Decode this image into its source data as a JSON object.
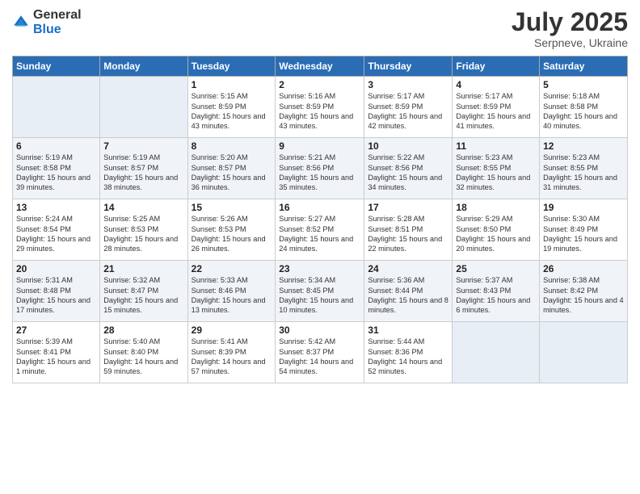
{
  "logo": {
    "general": "General",
    "blue": "Blue"
  },
  "title": "July 2025",
  "subtitle": "Serpneve, Ukraine",
  "header_days": [
    "Sunday",
    "Monday",
    "Tuesday",
    "Wednesday",
    "Thursday",
    "Friday",
    "Saturday"
  ],
  "weeks": [
    [
      {
        "day": "",
        "sunrise": "",
        "sunset": "",
        "daylight": ""
      },
      {
        "day": "",
        "sunrise": "",
        "sunset": "",
        "daylight": ""
      },
      {
        "day": "1",
        "sunrise": "Sunrise: 5:15 AM",
        "sunset": "Sunset: 8:59 PM",
        "daylight": "Daylight: 15 hours and 43 minutes."
      },
      {
        "day": "2",
        "sunrise": "Sunrise: 5:16 AM",
        "sunset": "Sunset: 8:59 PM",
        "daylight": "Daylight: 15 hours and 43 minutes."
      },
      {
        "day": "3",
        "sunrise": "Sunrise: 5:17 AM",
        "sunset": "Sunset: 8:59 PM",
        "daylight": "Daylight: 15 hours and 42 minutes."
      },
      {
        "day": "4",
        "sunrise": "Sunrise: 5:17 AM",
        "sunset": "Sunset: 8:59 PM",
        "daylight": "Daylight: 15 hours and 41 minutes."
      },
      {
        "day": "5",
        "sunrise": "Sunrise: 5:18 AM",
        "sunset": "Sunset: 8:58 PM",
        "daylight": "Daylight: 15 hours and 40 minutes."
      }
    ],
    [
      {
        "day": "6",
        "sunrise": "Sunrise: 5:19 AM",
        "sunset": "Sunset: 8:58 PM",
        "daylight": "Daylight: 15 hours and 39 minutes."
      },
      {
        "day": "7",
        "sunrise": "Sunrise: 5:19 AM",
        "sunset": "Sunset: 8:57 PM",
        "daylight": "Daylight: 15 hours and 38 minutes."
      },
      {
        "day": "8",
        "sunrise": "Sunrise: 5:20 AM",
        "sunset": "Sunset: 8:57 PM",
        "daylight": "Daylight: 15 hours and 36 minutes."
      },
      {
        "day": "9",
        "sunrise": "Sunrise: 5:21 AM",
        "sunset": "Sunset: 8:56 PM",
        "daylight": "Daylight: 15 hours and 35 minutes."
      },
      {
        "day": "10",
        "sunrise": "Sunrise: 5:22 AM",
        "sunset": "Sunset: 8:56 PM",
        "daylight": "Daylight: 15 hours and 34 minutes."
      },
      {
        "day": "11",
        "sunrise": "Sunrise: 5:23 AM",
        "sunset": "Sunset: 8:55 PM",
        "daylight": "Daylight: 15 hours and 32 minutes."
      },
      {
        "day": "12",
        "sunrise": "Sunrise: 5:23 AM",
        "sunset": "Sunset: 8:55 PM",
        "daylight": "Daylight: 15 hours and 31 minutes."
      }
    ],
    [
      {
        "day": "13",
        "sunrise": "Sunrise: 5:24 AM",
        "sunset": "Sunset: 8:54 PM",
        "daylight": "Daylight: 15 hours and 29 minutes."
      },
      {
        "day": "14",
        "sunrise": "Sunrise: 5:25 AM",
        "sunset": "Sunset: 8:53 PM",
        "daylight": "Daylight: 15 hours and 28 minutes."
      },
      {
        "day": "15",
        "sunrise": "Sunrise: 5:26 AM",
        "sunset": "Sunset: 8:53 PM",
        "daylight": "Daylight: 15 hours and 26 minutes."
      },
      {
        "day": "16",
        "sunrise": "Sunrise: 5:27 AM",
        "sunset": "Sunset: 8:52 PM",
        "daylight": "Daylight: 15 hours and 24 minutes."
      },
      {
        "day": "17",
        "sunrise": "Sunrise: 5:28 AM",
        "sunset": "Sunset: 8:51 PM",
        "daylight": "Daylight: 15 hours and 22 minutes."
      },
      {
        "day": "18",
        "sunrise": "Sunrise: 5:29 AM",
        "sunset": "Sunset: 8:50 PM",
        "daylight": "Daylight: 15 hours and 20 minutes."
      },
      {
        "day": "19",
        "sunrise": "Sunrise: 5:30 AM",
        "sunset": "Sunset: 8:49 PM",
        "daylight": "Daylight: 15 hours and 19 minutes."
      }
    ],
    [
      {
        "day": "20",
        "sunrise": "Sunrise: 5:31 AM",
        "sunset": "Sunset: 8:48 PM",
        "daylight": "Daylight: 15 hours and 17 minutes."
      },
      {
        "day": "21",
        "sunrise": "Sunrise: 5:32 AM",
        "sunset": "Sunset: 8:47 PM",
        "daylight": "Daylight: 15 hours and 15 minutes."
      },
      {
        "day": "22",
        "sunrise": "Sunrise: 5:33 AM",
        "sunset": "Sunset: 8:46 PM",
        "daylight": "Daylight: 15 hours and 13 minutes."
      },
      {
        "day": "23",
        "sunrise": "Sunrise: 5:34 AM",
        "sunset": "Sunset: 8:45 PM",
        "daylight": "Daylight: 15 hours and 10 minutes."
      },
      {
        "day": "24",
        "sunrise": "Sunrise: 5:36 AM",
        "sunset": "Sunset: 8:44 PM",
        "daylight": "Daylight: 15 hours and 8 minutes."
      },
      {
        "day": "25",
        "sunrise": "Sunrise: 5:37 AM",
        "sunset": "Sunset: 8:43 PM",
        "daylight": "Daylight: 15 hours and 6 minutes."
      },
      {
        "day": "26",
        "sunrise": "Sunrise: 5:38 AM",
        "sunset": "Sunset: 8:42 PM",
        "daylight": "Daylight: 15 hours and 4 minutes."
      }
    ],
    [
      {
        "day": "27",
        "sunrise": "Sunrise: 5:39 AM",
        "sunset": "Sunset: 8:41 PM",
        "daylight": "Daylight: 15 hours and 1 minute."
      },
      {
        "day": "28",
        "sunrise": "Sunrise: 5:40 AM",
        "sunset": "Sunset: 8:40 PM",
        "daylight": "Daylight: 14 hours and 59 minutes."
      },
      {
        "day": "29",
        "sunrise": "Sunrise: 5:41 AM",
        "sunset": "Sunset: 8:39 PM",
        "daylight": "Daylight: 14 hours and 57 minutes."
      },
      {
        "day": "30",
        "sunrise": "Sunrise: 5:42 AM",
        "sunset": "Sunset: 8:37 PM",
        "daylight": "Daylight: 14 hours and 54 minutes."
      },
      {
        "day": "31",
        "sunrise": "Sunrise: 5:44 AM",
        "sunset": "Sunset: 8:36 PM",
        "daylight": "Daylight: 14 hours and 52 minutes."
      },
      {
        "day": "",
        "sunrise": "",
        "sunset": "",
        "daylight": ""
      },
      {
        "day": "",
        "sunrise": "",
        "sunset": "",
        "daylight": ""
      }
    ]
  ]
}
